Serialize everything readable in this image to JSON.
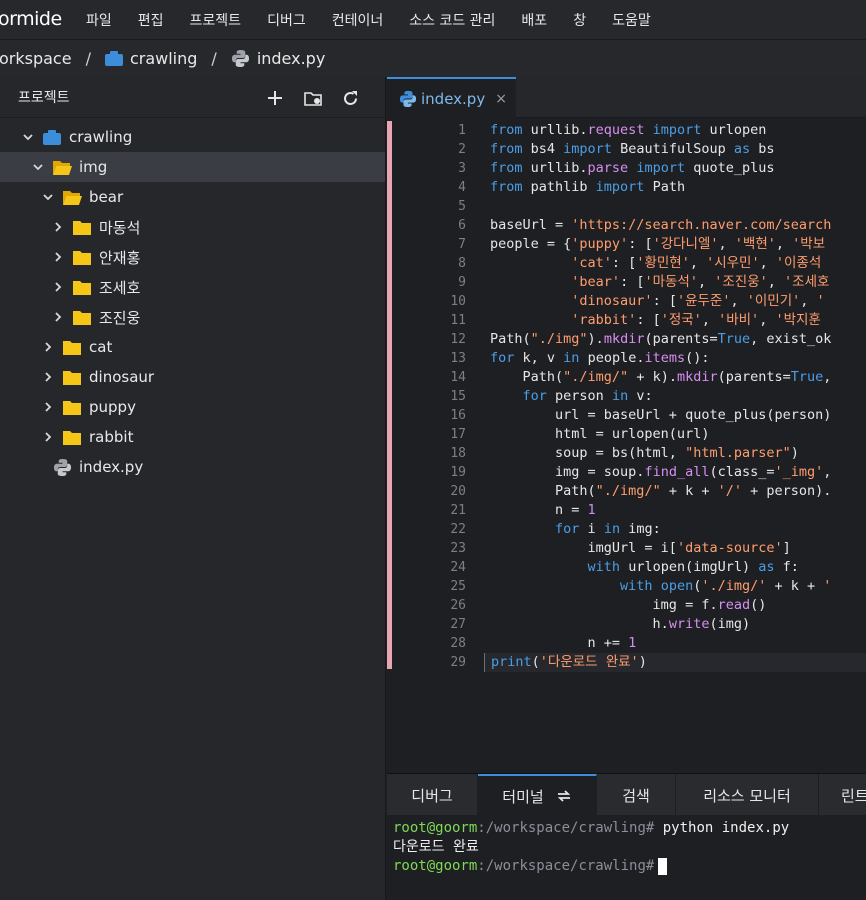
{
  "app": {
    "logo_text": "ormide"
  },
  "menu": [
    "파일",
    "편집",
    "프로젝트",
    "디버그",
    "컨테이너",
    "소스 코드 관리",
    "배포",
    "창",
    "도움말"
  ],
  "breadcrumb": {
    "workspace": "orkspace",
    "project": "crawling",
    "file": "index.py"
  },
  "sidebar": {
    "title": "프로젝트",
    "tree": [
      {
        "label": "crawling",
        "type": "project",
        "expanded": true,
        "depth": 0
      },
      {
        "label": "img",
        "type": "folder",
        "expanded": true,
        "depth": 1,
        "selected": true
      },
      {
        "label": "bear",
        "type": "folder",
        "expanded": true,
        "depth": 2
      },
      {
        "label": "마동석",
        "type": "folder",
        "expanded": false,
        "depth": 3
      },
      {
        "label": "안재홍",
        "type": "folder",
        "expanded": false,
        "depth": 3
      },
      {
        "label": "조세호",
        "type": "folder",
        "expanded": false,
        "depth": 3
      },
      {
        "label": "조진웅",
        "type": "folder",
        "expanded": false,
        "depth": 3
      },
      {
        "label": "cat",
        "type": "folder",
        "expanded": false,
        "depth": 2
      },
      {
        "label": "dinosaur",
        "type": "folder",
        "expanded": false,
        "depth": 2
      },
      {
        "label": "puppy",
        "type": "folder",
        "expanded": false,
        "depth": 2
      },
      {
        "label": "rabbit",
        "type": "folder",
        "expanded": false,
        "depth": 2
      },
      {
        "label": "index.py",
        "type": "python-file",
        "depth": 1
      }
    ]
  },
  "editor": {
    "tab_label": "index.py",
    "tab_close": "×",
    "line_numbers": [
      "1",
      "2",
      "3",
      "4",
      "5",
      "6",
      "7",
      "8",
      "9",
      "10",
      "11",
      "12",
      "13",
      "14",
      "15",
      "16",
      "17",
      "18",
      "19",
      "20",
      "21",
      "22",
      "23",
      "24",
      "25",
      "26",
      "27",
      "28",
      "29"
    ],
    "lines": [
      [
        [
          "kw",
          "from"
        ],
        [
          "nm",
          " urllib."
        ],
        [
          "fn",
          "request"
        ],
        [
          "nm",
          " "
        ],
        [
          "kw",
          "import"
        ],
        [
          "nm",
          " urlopen"
        ]
      ],
      [
        [
          "kw",
          "from"
        ],
        [
          "nm",
          " bs4 "
        ],
        [
          "kw",
          "import"
        ],
        [
          "nm",
          " BeautifulSoup "
        ],
        [
          "kw",
          "as"
        ],
        [
          "nm",
          " bs"
        ]
      ],
      [
        [
          "kw",
          "from"
        ],
        [
          "nm",
          " urllib."
        ],
        [
          "fn",
          "parse"
        ],
        [
          "nm",
          " "
        ],
        [
          "kw",
          "import"
        ],
        [
          "nm",
          " quote_plus"
        ]
      ],
      [
        [
          "kw",
          "from"
        ],
        [
          "nm",
          " pathlib "
        ],
        [
          "kw",
          "import"
        ],
        [
          "nm",
          " Path"
        ]
      ],
      [],
      [
        [
          "nm",
          "baseUrl = "
        ],
        [
          "str",
          "'https://search.naver.com/search"
        ]
      ],
      [
        [
          "nm",
          "people = {"
        ],
        [
          "str",
          "'puppy'"
        ],
        [
          "nm",
          ": ["
        ],
        [
          "str",
          "'강다니엘'"
        ],
        [
          "nm",
          ", "
        ],
        [
          "str",
          "'백현'"
        ],
        [
          "nm",
          ", "
        ],
        [
          "str",
          "'박보"
        ]
      ],
      [
        [
          "nm",
          "          "
        ],
        [
          "str",
          "'cat'"
        ],
        [
          "nm",
          ": ["
        ],
        [
          "str",
          "'황민현'"
        ],
        [
          "nm",
          ", "
        ],
        [
          "str",
          "'시우민'"
        ],
        [
          "nm",
          ", "
        ],
        [
          "str",
          "'이종석"
        ]
      ],
      [
        [
          "nm",
          "          "
        ],
        [
          "str",
          "'bear'"
        ],
        [
          "nm",
          ": ["
        ],
        [
          "str",
          "'마동석'"
        ],
        [
          "nm",
          ", "
        ],
        [
          "str",
          "'조진웅'"
        ],
        [
          "nm",
          ", "
        ],
        [
          "str",
          "'조세호"
        ]
      ],
      [
        [
          "nm",
          "          "
        ],
        [
          "str",
          "'dinosaur'"
        ],
        [
          "nm",
          ": ["
        ],
        [
          "str",
          "'윤두준'"
        ],
        [
          "nm",
          ", "
        ],
        [
          "str",
          "'이민기'"
        ],
        [
          "nm",
          ", "
        ],
        [
          "str",
          "'"
        ]
      ],
      [
        [
          "nm",
          "          "
        ],
        [
          "str",
          "'rabbit'"
        ],
        [
          "nm",
          ": ["
        ],
        [
          "str",
          "'정국'"
        ],
        [
          "nm",
          ", "
        ],
        [
          "str",
          "'바비'"
        ],
        [
          "nm",
          ", "
        ],
        [
          "str",
          "'박지훈"
        ]
      ],
      [
        [
          "nm",
          "Path("
        ],
        [
          "str",
          "\"./img\""
        ],
        [
          "nm",
          ")."
        ],
        [
          "fn",
          "mkdir"
        ],
        [
          "nm",
          "(parents="
        ],
        [
          "kw",
          "True"
        ],
        [
          "nm",
          ", exist_ok"
        ]
      ],
      [
        [
          "kw",
          "for"
        ],
        [
          "nm",
          " k, v "
        ],
        [
          "kw",
          "in"
        ],
        [
          "nm",
          " people."
        ],
        [
          "fn",
          "items"
        ],
        [
          "nm",
          "():"
        ]
      ],
      [
        [
          "nm",
          "    Path("
        ],
        [
          "str",
          "\"./img/\""
        ],
        [
          "nm",
          " + k)."
        ],
        [
          "fn",
          "mkdir"
        ],
        [
          "nm",
          "(parents="
        ],
        [
          "kw",
          "True"
        ],
        [
          "nm",
          ","
        ]
      ],
      [
        [
          "nm",
          "    "
        ],
        [
          "kw",
          "for"
        ],
        [
          "nm",
          " person "
        ],
        [
          "kw",
          "in"
        ],
        [
          "nm",
          " v:"
        ]
      ],
      [
        [
          "nm",
          "        url = baseUrl + quote_plus(person)"
        ]
      ],
      [
        [
          "nm",
          "        html = urlopen(url)"
        ]
      ],
      [
        [
          "nm",
          "        soup = bs(html, "
        ],
        [
          "str",
          "\"html.parser\""
        ],
        [
          "nm",
          ")"
        ]
      ],
      [
        [
          "nm",
          "        img = soup."
        ],
        [
          "fn",
          "find_all"
        ],
        [
          "nm",
          "(class_="
        ],
        [
          "str",
          "'_img'"
        ],
        [
          "nm",
          ","
        ]
      ],
      [
        [
          "nm",
          "        Path("
        ],
        [
          "str",
          "\"./img/\""
        ],
        [
          "nm",
          " + k + "
        ],
        [
          "str",
          "'/'"
        ],
        [
          "nm",
          " + person)."
        ]
      ],
      [
        [
          "nm",
          "        n = "
        ],
        [
          "num",
          "1"
        ]
      ],
      [
        [
          "nm",
          "        "
        ],
        [
          "kw",
          "for"
        ],
        [
          "nm",
          " i "
        ],
        [
          "kw",
          "in"
        ],
        [
          "nm",
          " img:"
        ]
      ],
      [
        [
          "nm",
          "            imgUrl = i["
        ],
        [
          "str",
          "'data-source'"
        ],
        [
          "nm",
          "]"
        ]
      ],
      [
        [
          "nm",
          "            "
        ],
        [
          "kw",
          "with"
        ],
        [
          "nm",
          " urlopen(imgUrl) "
        ],
        [
          "kw",
          "as"
        ],
        [
          "nm",
          " f:"
        ]
      ],
      [
        [
          "nm",
          "                "
        ],
        [
          "kw",
          "with"
        ],
        [
          "nm",
          " "
        ],
        [
          "kw",
          "open"
        ],
        [
          "nm",
          "("
        ],
        [
          "str",
          "'./img/'"
        ],
        [
          "nm",
          " + k + "
        ],
        [
          "str",
          "'"
        ]
      ],
      [
        [
          "nm",
          "                    img = f."
        ],
        [
          "fn",
          "read"
        ],
        [
          "nm",
          "()"
        ]
      ],
      [
        [
          "nm",
          "                    h."
        ],
        [
          "fn",
          "write"
        ],
        [
          "nm",
          "(img)"
        ]
      ],
      [
        [
          "nm",
          "            n += "
        ],
        [
          "num",
          "1"
        ]
      ],
      [
        [
          "kw",
          "print"
        ],
        [
          "nm",
          "("
        ],
        [
          "str",
          "'다운로드 완료'"
        ],
        [
          "nm",
          ")"
        ]
      ]
    ]
  },
  "bottom_panel": {
    "tabs": [
      "디버그",
      "터미널",
      "검색",
      "리소스 모니터",
      "린트"
    ],
    "active_tab": "터미널"
  },
  "terminal": {
    "line1": {
      "user": "root@goorm",
      "path": ":/workspace/crawling#",
      "cmd": " python index.py"
    },
    "line2": "다운로드 완료",
    "line3": {
      "user": "root@goorm",
      "path": ":/workspace/crawling#",
      "cmd": ""
    }
  },
  "colors": {
    "accent": "#3d8eda",
    "folder": "#f5c518",
    "project": "#3d8eda",
    "keyword": "#4b9ee6",
    "string": "#ff9d6e"
  }
}
